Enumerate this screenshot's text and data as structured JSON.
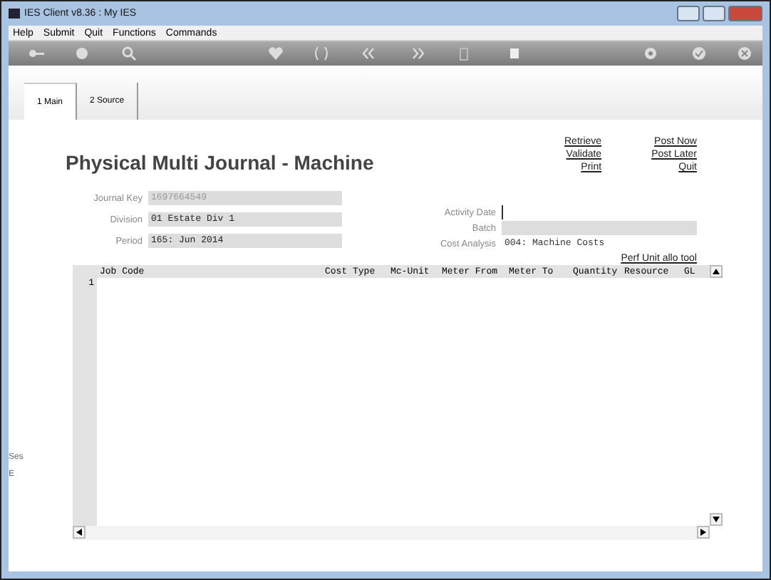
{
  "window": {
    "title": "IES Client v8.36 : My IES"
  },
  "menu": [
    "Help",
    "Submit",
    "Quit",
    "Functions",
    "Commands"
  ],
  "tabs": [
    {
      "label": "1 Main",
      "selected": true
    },
    {
      "label": "2 Source",
      "selected": false
    }
  ],
  "form_title": "Physical Multi Journal - Machine",
  "actions": [
    [
      "Retrieve",
      "Validate",
      "Print"
    ],
    [
      "Post Now",
      "Post Later",
      "Quit"
    ]
  ],
  "left_fields": [
    {
      "label": "Journal Key",
      "value": "1697664549",
      "disabled": true
    },
    {
      "label": "Division",
      "value": "01 Estate Div 1",
      "disabled": false
    },
    {
      "label": "Period",
      "value": "165: Jun 2014",
      "disabled": false
    }
  ],
  "right_fields": [
    {
      "label": "Activity Date",
      "kind": "input"
    },
    {
      "label": "Batch",
      "kind": "grey"
    },
    {
      "label": "Cost Analysis",
      "value": "004: Machine Costs",
      "kind": "plain"
    }
  ],
  "tool_link": "Perf Unit allo tool",
  "table": {
    "columns": [
      "Job Code",
      "Cost Type",
      "Mc-Unit",
      "Meter From",
      "Meter To",
      "Quantity",
      "Resource",
      "GL"
    ],
    "rows": [
      {
        "number": "1"
      }
    ]
  },
  "side_fragments": [
    "Ses",
    "E"
  ]
}
